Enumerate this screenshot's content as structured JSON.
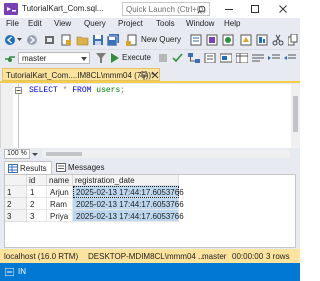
{
  "window": {
    "title": "TutorialKart_Com.sql...",
    "quick_launch_placeholder": "Quick Launch (Ctrl+Q)",
    "controls": [
      "minimize",
      "maximize",
      "close"
    ]
  },
  "menu": {
    "items": [
      "File",
      "Edit",
      "View",
      "Query",
      "Project",
      "Tools",
      "Window",
      "Help"
    ]
  },
  "toolbar": {
    "new_query_label": "New Query",
    "database": "master",
    "execute_label": "Execute"
  },
  "document_tab": {
    "label": "TutorialKart_Com....IM8CL\\mmm04 (75))*"
  },
  "editor": {
    "sql": {
      "select": "SELECT",
      "star": "*",
      "from": "FROM",
      "table": "users",
      "end": ";"
    }
  },
  "zoom": {
    "value": "100 %"
  },
  "results": {
    "tabs": {
      "results": "Results",
      "messages": "Messages"
    },
    "columns": [
      "id",
      "name",
      "registration_date"
    ],
    "rows": [
      {
        "num": "1",
        "id": "1",
        "name": "Arjun",
        "registration_date": "2025-02-13 17:44:17.6053766"
      },
      {
        "num": "2",
        "id": "2",
        "name": "Ram",
        "registration_date": "2025-02-13 17:44:17.6053766"
      },
      {
        "num": "3",
        "id": "3",
        "name": "Priya",
        "registration_date": "2025-02-13 17:44:17.6053766"
      }
    ]
  },
  "status": {
    "server": "localhost (16.0 RTM)",
    "user": "DESKTOP-MDIM8CL\\mmm04 ...",
    "database": "master",
    "time": "00:00:00",
    "rows": "3 rows"
  },
  "bottom": {
    "mode": "IN"
  },
  "colors": {
    "chrome": "#e8eaf1",
    "tab_accent": "#fce49f",
    "status_blue": "#0078d4",
    "selection": "#bdd7ee"
  }
}
